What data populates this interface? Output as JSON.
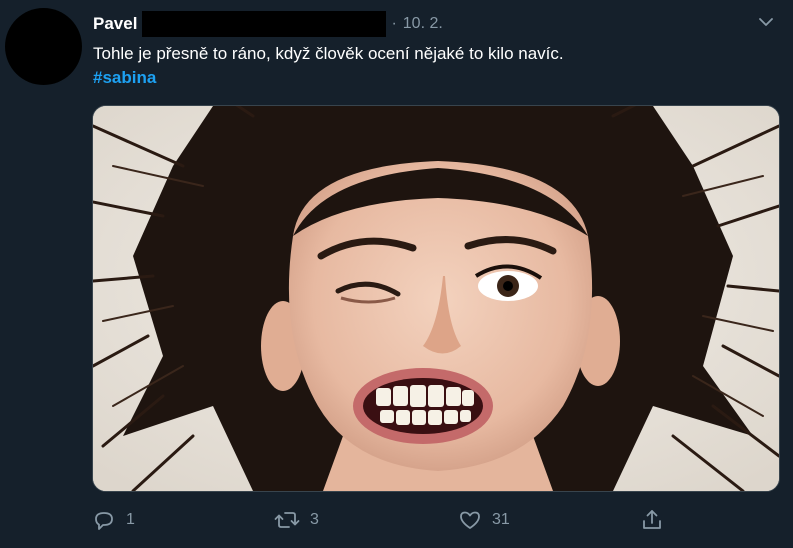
{
  "tweet": {
    "display_name": "Pavel",
    "separator": "·",
    "date": "10. 2.",
    "text": "Tohle je přesně to ráno, když člověk ocení nějaké to kilo navíc.",
    "hashtag": "#sabina",
    "media_icon": "photo-woman-grimacing"
  },
  "actions": {
    "reply_count": "1",
    "retweet_count": "3",
    "like_count": "31"
  },
  "colors": {
    "background": "#15202b",
    "secondary_text": "#8899a6",
    "link": "#1da1f2",
    "border": "#38444d"
  }
}
